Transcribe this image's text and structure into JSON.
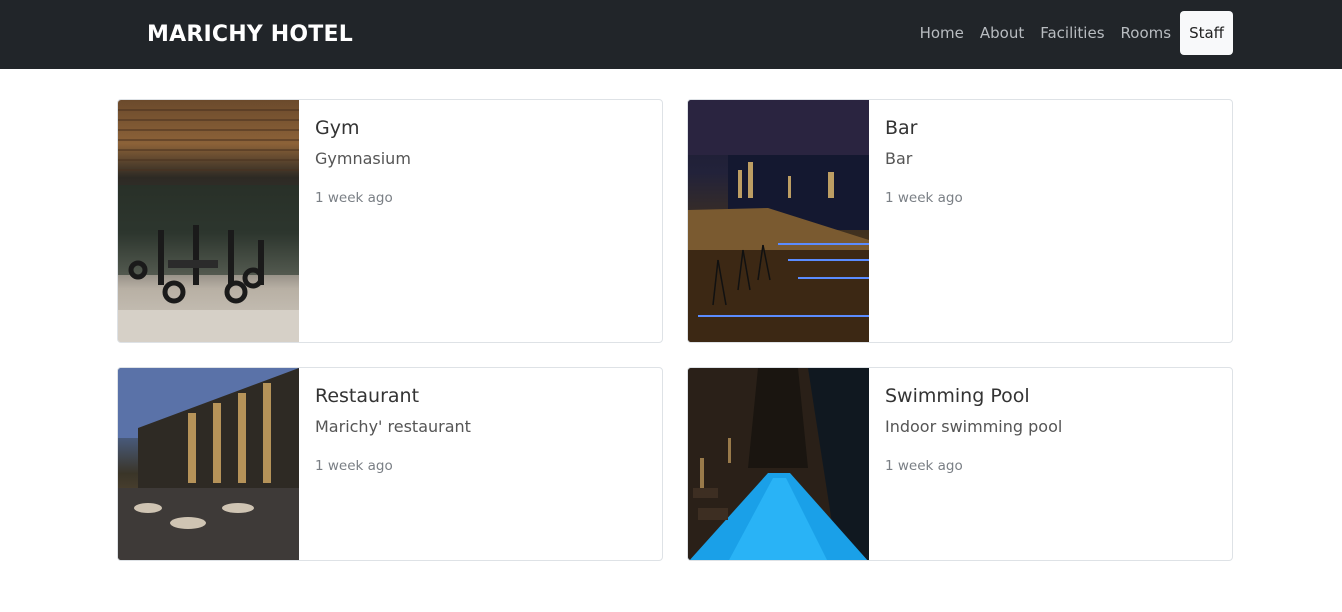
{
  "navbar": {
    "brand": "MARICHY HOTEL",
    "links": [
      "Home",
      "About",
      "Facilities",
      "Rooms",
      "Staff"
    ],
    "active": "Staff"
  },
  "cards": [
    {
      "title": "Gym",
      "description": "Gymnasium",
      "time": "1 week ago"
    },
    {
      "title": "Bar",
      "description": "Bar",
      "time": "1 week ago"
    },
    {
      "title": "Restaurant",
      "description": "Marichy' restaurant",
      "time": "1 week ago"
    },
    {
      "title": "Swimming Pool",
      "description": "Indoor swimming pool",
      "time": "1 week ago"
    }
  ],
  "colors": {
    "navbar_bg": "#212529",
    "active_link_bg": "#f8f9fa",
    "card_border": "#dee2e6"
  }
}
